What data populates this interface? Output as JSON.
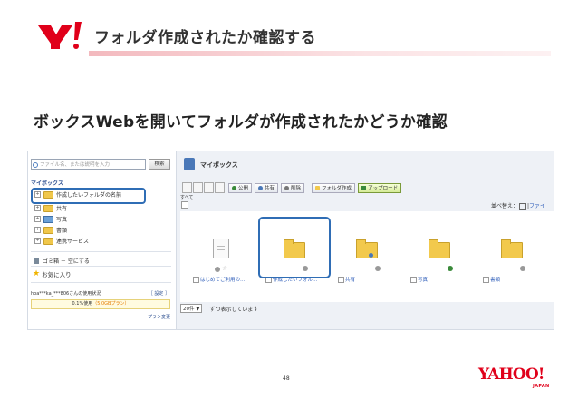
{
  "header": {
    "slide_title": "フォルダ作成されたか確認する",
    "subtitle": "ボックスWebを開いてフォルダが作成されたかどうか確認"
  },
  "sidebar": {
    "search_placeholder": "ファイル名、または説明を入力",
    "search_button": "検索",
    "section_title": "マイボックス",
    "tree": [
      {
        "label": "作成したいフォルダの名前",
        "icon": "folder-icon"
      },
      {
        "label": "共有",
        "icon": "shared-folder-icon"
      },
      {
        "label": "写真",
        "icon": "photo-folder-icon"
      },
      {
        "label": "書類",
        "icon": "document-folder-icon"
      },
      {
        "label": "連携サービス",
        "icon": "folder-icon"
      }
    ],
    "trash": "ゴミ箱 － 空にする",
    "favorites": "お気に入り",
    "usage_label": "hoa***ka_***806さんの使用状況",
    "settings_link": "［ 設定 ］",
    "usage_text": "0.1%使用",
    "usage_plan": "（5.0GBプラン）",
    "plan_change": "プラン変更"
  },
  "main": {
    "title": "マイボックス",
    "toolbar": {
      "public": "公開",
      "share": "共有",
      "delete": "削除",
      "create_folder": "フォルダ作成",
      "upload": "アップロード"
    },
    "all_label": "すべて",
    "sort_label": "並べ替え：",
    "sort_link": "ファイ",
    "items": [
      {
        "name": "はじめてご利用の…",
        "type": "document"
      },
      {
        "name": "作成したいフォル…",
        "type": "folder"
      },
      {
        "name": "共有",
        "type": "shared-folder"
      },
      {
        "name": "写真",
        "type": "photo-folder"
      },
      {
        "name": "書類",
        "type": "document-folder"
      }
    ],
    "pager_select": "20件 ▼",
    "pager_text": "ずつ表示しています"
  },
  "footer": {
    "page_number": "48",
    "logo_text": "YAHOO!",
    "logo_sub": "JAPAN"
  },
  "colors": {
    "highlight": "#2f6db5",
    "brand_red": "#e0001a",
    "folder": "#f2c94c"
  }
}
